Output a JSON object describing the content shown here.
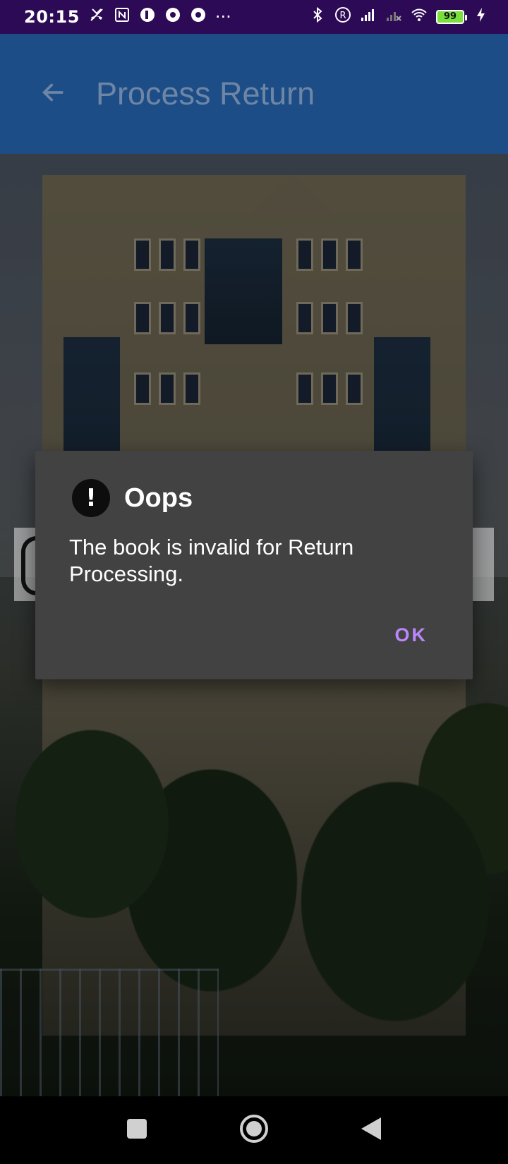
{
  "status_bar": {
    "time": "20:15",
    "more_indicator": "···",
    "battery_level": "99",
    "icons": [
      "missed-call-icon",
      "nfc-icon",
      "app-notification-icon",
      "chrome-icon",
      "chrome-icon",
      "bluetooth-icon",
      "registered-icon",
      "signal-icon",
      "signal-no-service-icon",
      "wifi-icon",
      "battery-icon",
      "charging-icon"
    ]
  },
  "app_bar": {
    "title": "Process Return",
    "back_icon": "arrow-left-icon",
    "background_color": "#1d4d86"
  },
  "dialog": {
    "icon": "exclamation-circle-icon",
    "icon_glyph": "!",
    "title": "Oops",
    "message": "The book is invalid for Return Processing.",
    "ok_label": "OK",
    "accent_color": "#bb86fc"
  },
  "nav_bar": {
    "buttons": [
      "recents-square-icon",
      "home-circle-icon",
      "back-triangle-icon"
    ]
  }
}
